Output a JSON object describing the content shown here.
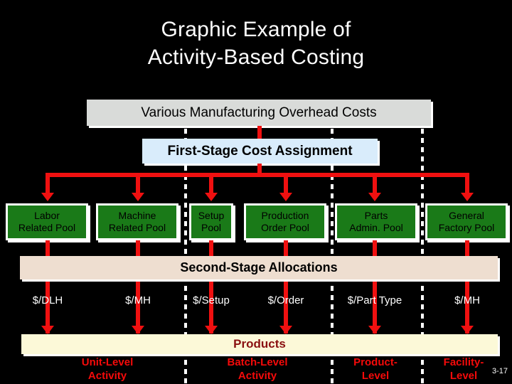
{
  "slide": {
    "title_line1": "Graphic Example of",
    "title_line2": "Activity-Based Costing",
    "number": "3-17",
    "background_color": "#000000"
  },
  "banners": {
    "overhead": {
      "label": "Various Manufacturing Overhead Costs",
      "color": "#d9dbd9"
    },
    "first_stage": {
      "label": "First-Stage Cost Assignment",
      "color": "#d9ecfb"
    },
    "second_stage": {
      "label": "Second-Stage Allocations",
      "color": "#eeded0"
    },
    "products": {
      "label": "Products",
      "color": "#fcf9d8",
      "text_color": "#8a1010"
    }
  },
  "pools": [
    {
      "line1": "Labor",
      "line2": "Related Pool"
    },
    {
      "line1": "Machine",
      "line2": "Related Pool"
    },
    {
      "line1": "Setup",
      "line2": "Pool"
    },
    {
      "line1": "Production",
      "line2": "Order Pool"
    },
    {
      "line1": "Parts",
      "line2": "Admin. Pool"
    },
    {
      "line1": "General",
      "line2": "Factory Pool"
    }
  ],
  "rates": [
    {
      "label": "$/DLH"
    },
    {
      "label": "$/MH"
    },
    {
      "label": "$/Setup"
    },
    {
      "label": "$/Order"
    },
    {
      "label": "$/Part Type"
    },
    {
      "label": "$/MH"
    }
  ],
  "activities": [
    {
      "line1": "Unit-Level",
      "line2": "Activity"
    },
    {
      "line1": "Batch-Level",
      "line2": "Activity"
    },
    {
      "line1": "Product-",
      "line2": "Level"
    },
    {
      "line1": "Facility-",
      "line2": "Level"
    }
  ],
  "accents": {
    "arrow_red": "#f01010",
    "pool_green": "#1a7a18",
    "activity_red": "#f50a0a"
  }
}
